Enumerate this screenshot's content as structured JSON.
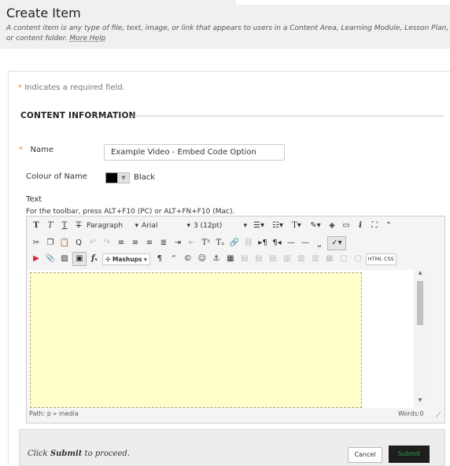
{
  "header": {
    "title": "Create Item",
    "description": "A content item is any type of file, text, image, or link that appears to users in a Content Area, Learning Module, Lesson Plan, or content folder.",
    "more_help": "More Help"
  },
  "form": {
    "required_star": "*",
    "required_note": "Indicates a required field.",
    "section_title": "CONTENT INFORMATION",
    "name_label": "Name",
    "name_value": "Example Video - Embed Code Option",
    "colour_label": "Colour of Name",
    "colour_value": "Black",
    "colour_hex": "#000000",
    "text_label": "Text",
    "toolbar_hint": "For the toolbar, press ALT+F10 (PC) or ALT+FN+F10 (Mac)."
  },
  "editor": {
    "format": "Paragraph",
    "font": "Arial",
    "size": "3 (12pt)",
    "mashups": "Mashups",
    "html_css": "HTML CSS",
    "path": "Path: p » media",
    "words": "Words:0"
  },
  "footer": {
    "instruction_pre": "Click ",
    "instruction_strong": "Submit",
    "instruction_post": " to proceed.",
    "cancel": "Cancel",
    "submit": "Submit"
  },
  "colors": {
    "accent_star": "#e48b2f",
    "submit_text": "#2f9b49",
    "editor_bg": "#ffffcc"
  }
}
